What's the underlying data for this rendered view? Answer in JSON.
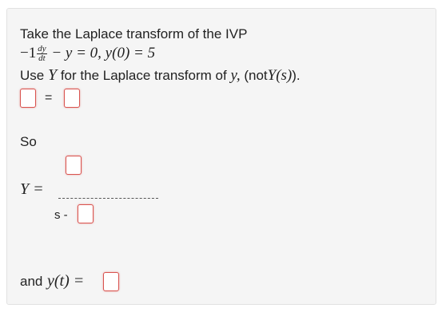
{
  "question": {
    "intro": "Take the Laplace transform of the IVP",
    "ivp": {
      "coefficient": "−1",
      "derivative_num": "dy",
      "derivative_den": "dt",
      "rest_of_equation": "− y = 0, y(0) = 5"
    },
    "instruction_prefix": "Use",
    "instruction_var": "Y",
    "instruction_middle": "for the Laplace transform of",
    "instruction_y": "y,",
    "instruction_suffix_open": "(not",
    "instruction_Ys": "Y(s)",
    "instruction_suffix_close": ")."
  },
  "first_equation": {
    "equals_sign": "="
  },
  "so_label": "So",
  "solution": {
    "lhs": "Y =",
    "denominator_prefix": "s -"
  },
  "final": {
    "label": "and",
    "expr": "y(t) ="
  },
  "colors": {
    "input_border": "#d9534f",
    "card_background": "#f5f5f5"
  }
}
